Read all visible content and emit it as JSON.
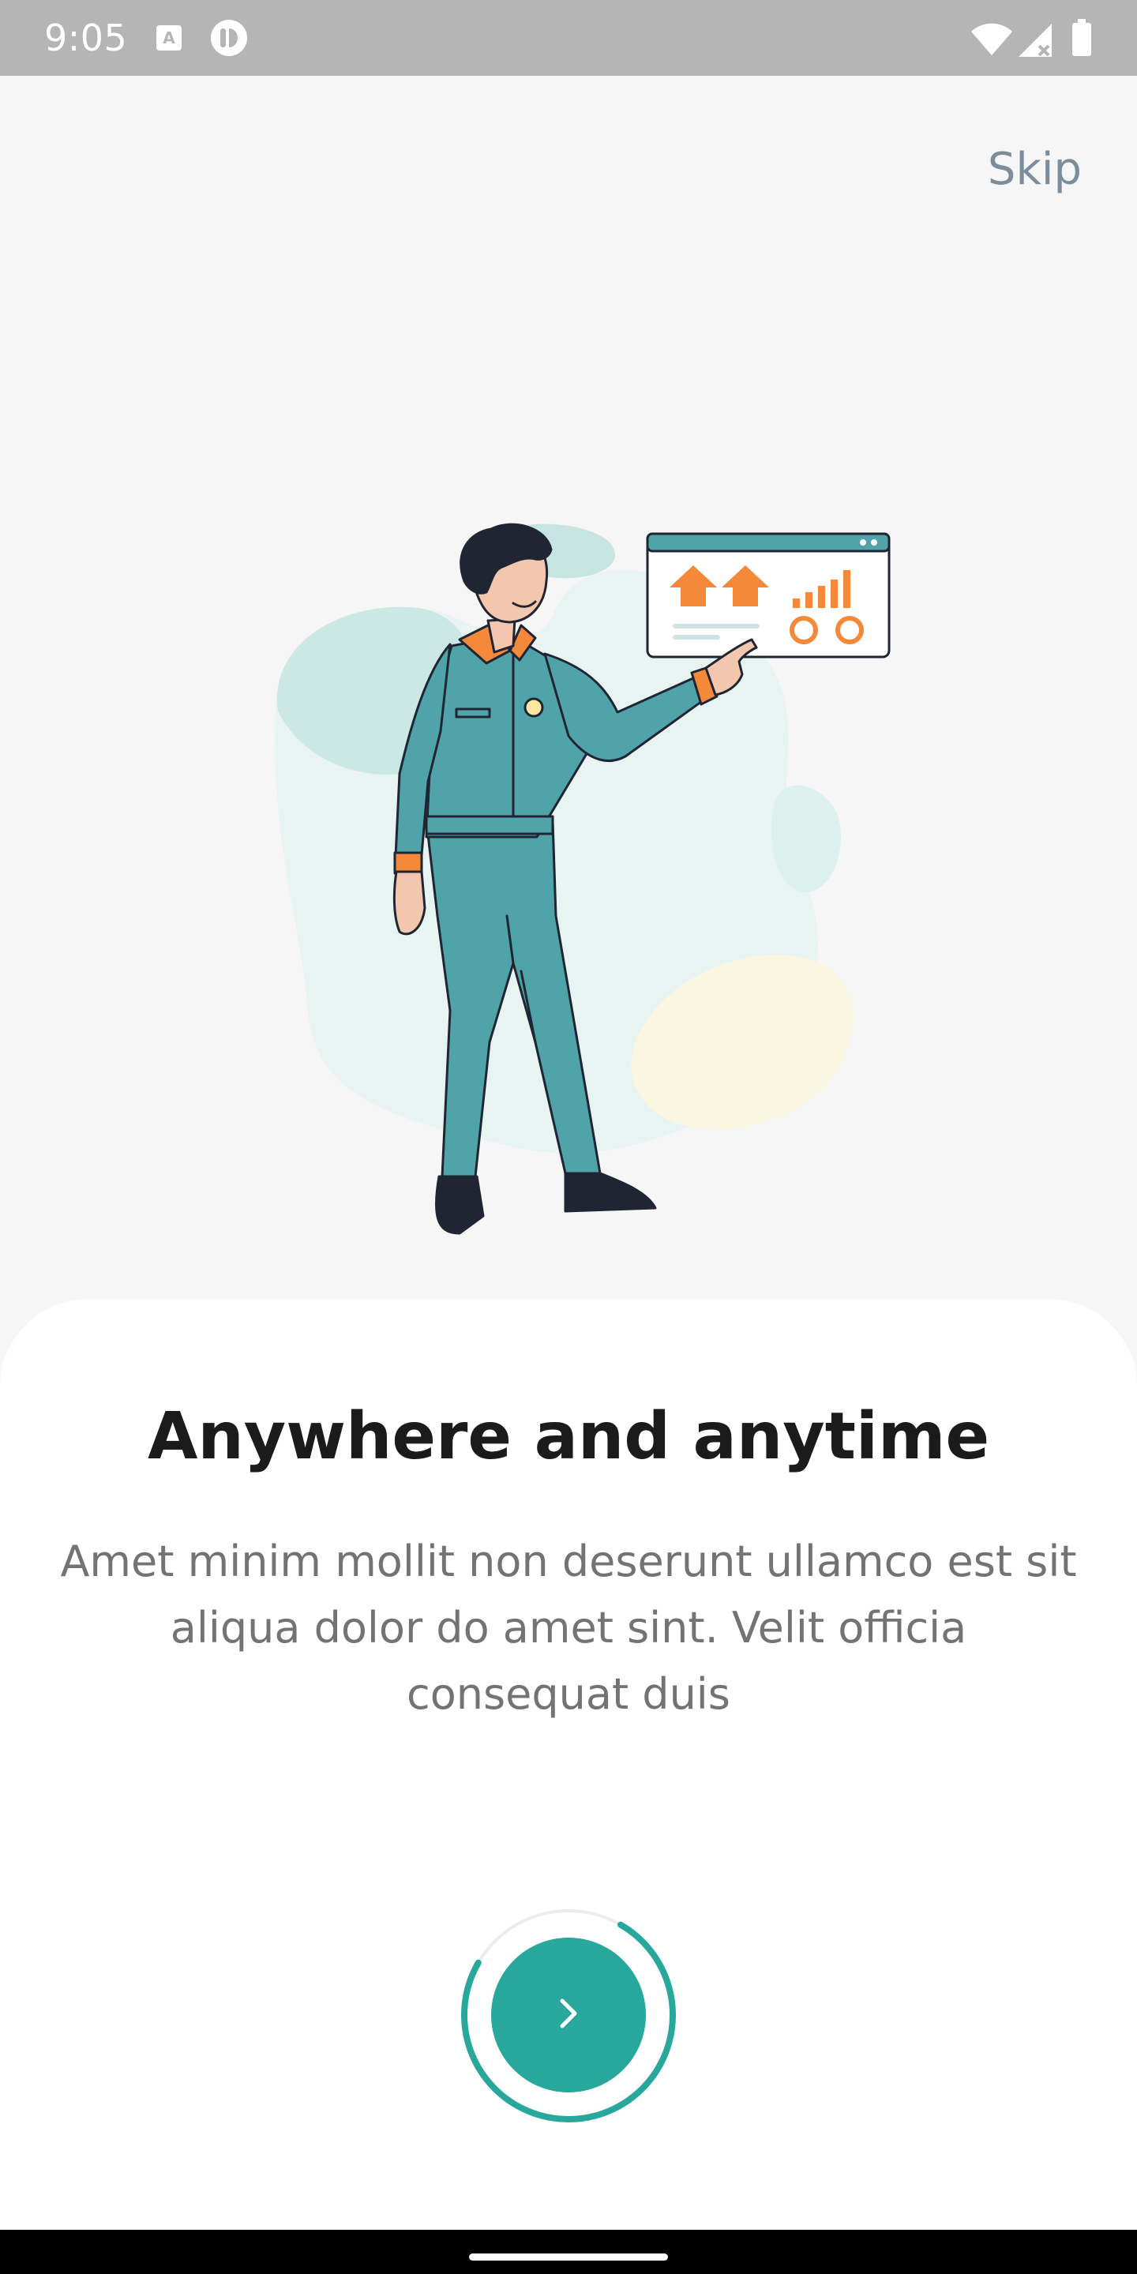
{
  "status_bar": {
    "time": "9:05",
    "icons": [
      "a-notification-icon",
      "app-notification-icon",
      "wifi-icon",
      "signal-icon",
      "battery-icon"
    ]
  },
  "skip": {
    "label": "Skip"
  },
  "onboarding": {
    "title": "Anywhere and anytime",
    "description": "Amet minim mollit non deserunt ullamco est sit aliqua dolor do amet sint. Velit officia consequat duis"
  },
  "next_button": {
    "icon": "chevron-right-icon",
    "progress": 0.75
  },
  "colors": {
    "accent": "#28a89c",
    "title": "#1b1b1b",
    "body": "#737373",
    "skip": "#7d8c9b",
    "illustration_orange": "#f5893a",
    "illustration_teal": "#4fa3a9"
  }
}
